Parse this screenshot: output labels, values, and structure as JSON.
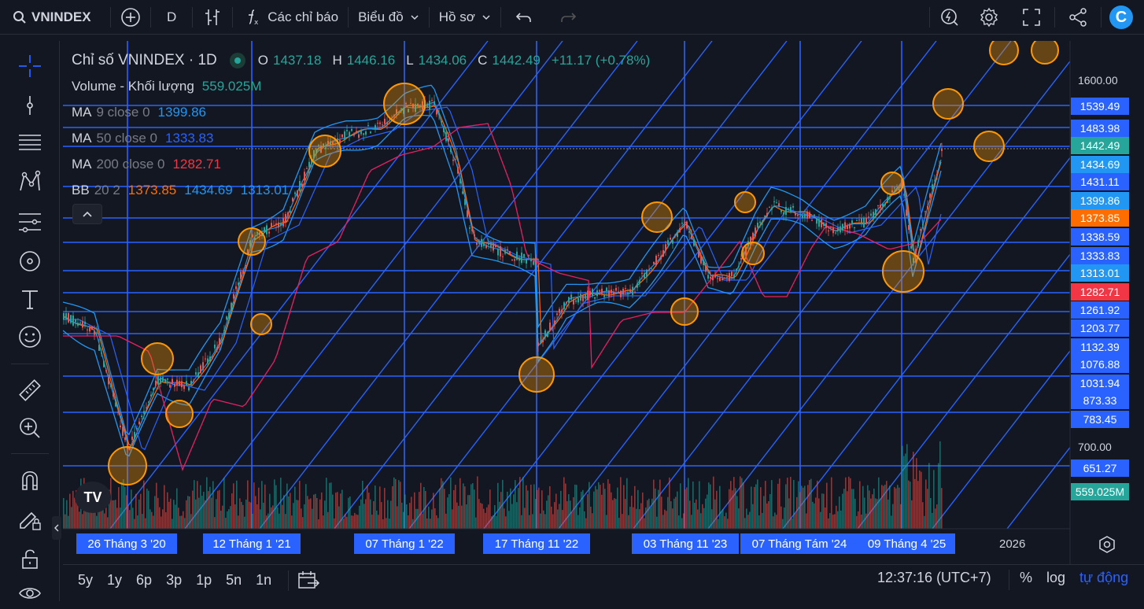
{
  "topbar": {
    "symbol": "VNINDEX",
    "interval": "D",
    "indicators_label": "Các chỉ báo",
    "chart_type_label": "Biểu đồ",
    "profile_label": "Hồ sơ",
    "logo_letter": "C"
  },
  "legend": {
    "title": "Chỉ số VNINDEX · 1D",
    "o_label": "O",
    "o_value": "1437.18",
    "h_label": "H",
    "h_value": "1446.16",
    "l_label": "L",
    "l_value": "1434.06",
    "c_label": "C",
    "c_value": "1442.49",
    "change": "+11.17 (+0.78%)",
    "volume_label": "Volume - Khối lượng",
    "volume_value": "559.025M",
    "ma9_label": "MA",
    "ma9_params": "9 close 0",
    "ma9_value": "1399.86",
    "ma50_label": "MA",
    "ma50_params": "50 close 0",
    "ma50_value": "1333.83",
    "ma200_label": "MA",
    "ma200_params": "200 close 0",
    "ma200_value": "1282.71",
    "bb_label": "BB",
    "bb_params": "20 2",
    "bb_basis": "1373.85",
    "bb_upper": "1434.69",
    "bb_lower": "1313.01"
  },
  "price_scale": {
    "ticks": [
      "1600.00",
      "700.00"
    ],
    "labels": [
      {
        "text": "1539.49",
        "color": "#2962ff"
      },
      {
        "text": "1483.98",
        "color": "#2962ff"
      },
      {
        "text": "1442.49",
        "color": "#26a69a"
      },
      {
        "text": "1434.69",
        "color": "#2196f3"
      },
      {
        "text": "1431.11",
        "color": "#2962ff"
      },
      {
        "text": "1399.86",
        "color": "#2196f3"
      },
      {
        "text": "1373.85",
        "color": "#ff6d00"
      },
      {
        "text": "1338.59",
        "color": "#2962ff"
      },
      {
        "text": "1333.83",
        "color": "#2962ff"
      },
      {
        "text": "1313.01",
        "color": "#2196f3"
      },
      {
        "text": "1282.71",
        "color": "#f23645"
      },
      {
        "text": "1261.92",
        "color": "#2962ff"
      },
      {
        "text": "1203.77",
        "color": "#2962ff"
      },
      {
        "text": "1132.39",
        "color": "#2962ff"
      },
      {
        "text": "1076.88",
        "color": "#2962ff"
      },
      {
        "text": "1031.94",
        "color": "#2962ff"
      },
      {
        "text": "873.33",
        "color": "#2962ff"
      },
      {
        "text": "783.45",
        "color": "#2962ff"
      },
      {
        "text": "651.27",
        "color": "#2962ff"
      },
      {
        "text": "559.025M",
        "color": "#26a69a"
      }
    ]
  },
  "time_scale": {
    "labels": [
      "26 Tháng 3 '20",
      "12 Tháng 1 '21",
      "07 Tháng 1 '22",
      "17 Tháng 11 '22",
      "03 Tháng 11 '23",
      "07 Tháng Tám '24",
      "09 Tháng 4 '25"
    ],
    "year": "2026"
  },
  "bottombar": {
    "ranges": [
      "5y",
      "1y",
      "6p",
      "3p",
      "1p",
      "5n",
      "1n"
    ],
    "clock": "12:37:16 (UTC+7)",
    "percent": "%",
    "log": "log",
    "auto": "tự động"
  },
  "tv_logo_text": "TV",
  "colors": {
    "background": "#131722",
    "line_blue": "#2962ff",
    "circle_orange": "#ff9800",
    "up": "#26a69a",
    "down": "#ef5350",
    "ma200": "#e91e63",
    "bb": "#2196f3"
  }
}
